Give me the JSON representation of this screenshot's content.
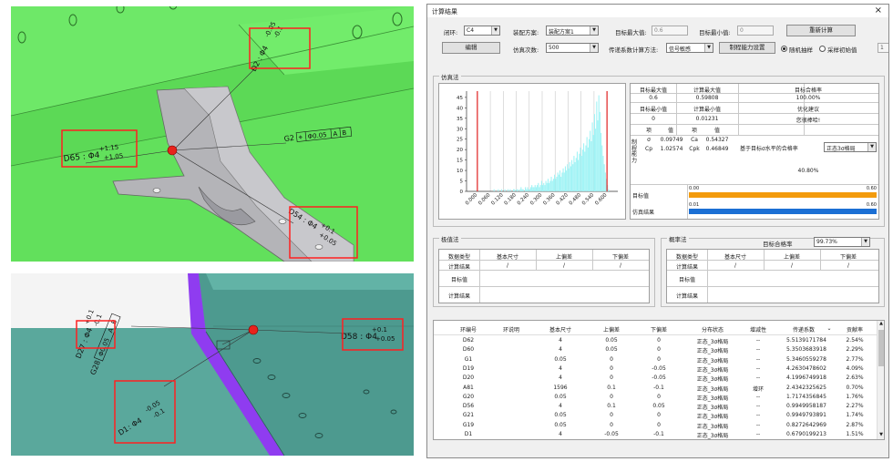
{
  "viewport_top": {
    "annotations": {
      "d2x": "D2",
      "d2x_lower": "-0.05",
      "d2x_upper": "-0.1",
      "d2x_size": ": Φ4",
      "d65_label": "D65 : Φ4",
      "d65_upper": "+1.15",
      "d65_lower": "+1.05",
      "g2x_label": "G2",
      "g2x_symbol": "⌖",
      "g2x_tol": "Φ0.05",
      "g2x_ref_a": "A",
      "g2x_ref_b": "B",
      "d54_label": "D54 : Φ4",
      "d54_upper": "+0.1",
      "d54_lower": "+0.05"
    },
    "colors": {
      "panel": "#62e05c",
      "part": "#a8a8ac",
      "highlight": "#ff2020",
      "marker": "#e8231c"
    }
  },
  "viewport_bottom": {
    "annotations": {
      "d27_label": "D27 : Φ4",
      "d27_upper": "+0.1",
      "d27_lower": "-0.1",
      "g28_label": "G28",
      "g28_tol": "Φ0.05",
      "g28_ref_a": "A",
      "g28_ref_b": "B",
      "d58_label": "D58 : Φ4",
      "d58_upper": "+0.1",
      "d58_lower": "+0.05",
      "d18_label": "D1",
      "d18_size": ": Φ4",
      "d18_upper": "-0.05",
      "d18_lower": "-0.1"
    },
    "colors": {
      "panel": "#4d9a8f",
      "edge": "#8f3cf0"
    }
  },
  "dialog": {
    "title": "计算结果",
    "close": "×",
    "toolbar": {
      "ring_label": "闭环:",
      "ring_value": "C4",
      "plan_label": "装配方案:",
      "plan_value": "装配方案1",
      "target_max_label": "目标最大值:",
      "target_max_value": "0.6",
      "target_min_label": "目标最小值:",
      "target_min_value": "0",
      "recalc_button": "重新计算",
      "edit_button": "编辑",
      "sim_count_label": "仿真次数:",
      "sim_count_value": "500",
      "coef_method_label": "传递系数计算方法:",
      "coef_method_value": "信号敏感",
      "control_setting_button": "制程能力设置",
      "random_sampling_label": "随机抽样",
      "initial_value_label": "采样初始值",
      "initial_value": "1"
    },
    "simulation": {
      "group_label": "仿真法",
      "stats": {
        "max_label": "目标最大值",
        "max_value": "0.6",
        "calc_max_label": "计算最大值",
        "calc_max_value": "0.59808",
        "pass_rate_label": "目标合格率",
        "pass_rate_value": "100.00%",
        "min_label": "目标最小值",
        "min_value": "0",
        "calc_min_label": "计算最小值",
        "calc_min_value": "0.01231",
        "optimize_label": "优化建议",
        "optimize_value": "您很棒哈!",
        "item_label": "项",
        "value_label": "值",
        "sigma_label": "σ",
        "sigma_value": "0.09749",
        "ca_label": "Ca",
        "ca_value": "0.54327",
        "cp_label": "Cp",
        "cp_value": "1.02574",
        "cpk_label": "Cpk",
        "cpk_value": "0.46849",
        "side_label": "制程能力",
        "sigma_rate_label": "基于目标σ水平的合格率",
        "sigma_rate_combo": "正态3σ格局",
        "sigma_rate_value": "40.80%",
        "target_bar_label": "目标值",
        "target_bar_left": "0.00",
        "target_bar_right": "0.60",
        "sim_bar_label": "仿真结果",
        "sim_bar_left": "0.01",
        "sim_bar_right": "0.60"
      }
    },
    "extreme": {
      "group_label": "极值法",
      "headers": [
        "数据类型",
        "基本尺寸",
        "上偏差",
        "下偏差"
      ],
      "row1": [
        "计算结果",
        "/",
        "/",
        "/"
      ],
      "row2_label": "目标值",
      "row3_label": "计算结果"
    },
    "probability": {
      "group_label": "概率法",
      "target_rate_label": "目标合格率",
      "target_rate_value": "99.73%",
      "headers": [
        "数据类型",
        "基本尺寸",
        "上偏差",
        "下偏差"
      ],
      "row1": [
        "计算结果",
        "/",
        "/",
        "/"
      ],
      "row2_label": "目标值",
      "row3_label": "计算结果"
    },
    "table": {
      "headers": [
        "环编号",
        "环说明",
        "基本尺寸",
        "上偏差",
        "下偏差",
        "分布状态",
        "增减性",
        "传递系数",
        "贡献率"
      ],
      "rows": [
        [
          "D62",
          "",
          "4",
          "0.05",
          "0",
          "正态_3σ格局",
          "--",
          "5.5139171784",
          "2.54%"
        ],
        [
          "D60",
          "",
          "4",
          "0.05",
          "0",
          "正态_3σ格局",
          "--",
          "5.3503683918",
          "2.29%"
        ],
        [
          "G1",
          "",
          "0.05",
          "0",
          "0",
          "正态_3σ格局",
          "--",
          "5.3460559278",
          "2.77%"
        ],
        [
          "D19",
          "",
          "4",
          "0",
          "-0.05",
          "正态_3σ格局",
          "--",
          "4.2630478602",
          "4.09%"
        ],
        [
          "D20",
          "",
          "4",
          "0",
          "-0.05",
          "正态_3σ格局",
          "--",
          "4.1996749918",
          "2.63%"
        ],
        [
          "A81",
          "",
          "1596",
          "0.1",
          "-0.1",
          "正态_3σ格局",
          "增环",
          "2.4342325625",
          "0.70%"
        ],
        [
          "G20",
          "",
          "0.05",
          "0",
          "0",
          "正态_3σ格局",
          "--",
          "1.7174356845",
          "1.76%"
        ],
        [
          "D56",
          "",
          "4",
          "0.1",
          "0.05",
          "正态_3σ格局",
          "--",
          "0.9949958187",
          "2.27%"
        ],
        [
          "G21",
          "",
          "0.05",
          "0",
          "0",
          "正态_3σ格局",
          "--",
          "0.9949793891",
          "1.74%"
        ],
        [
          "G19",
          "",
          "0.05",
          "0",
          "0",
          "正态_3σ格局",
          "--",
          "0.8272642969",
          "2.87%"
        ],
        [
          "D1",
          "",
          "4",
          "-0.05",
          "-0.1",
          "正态_3σ格局",
          "--",
          "0.6790199213",
          "1.51%"
        ]
      ],
      "sort_icon": "chevron-down-icon"
    }
  },
  "chart_data": {
    "type": "bar",
    "title": "",
    "xlabel": "",
    "ylabel": "",
    "ylim": [
      0,
      48
    ],
    "xlim": [
      -0.05,
      0.65
    ],
    "x_ticks": [
      "0.000",
      "0.060",
      "0.120",
      "0.180",
      "0.240",
      "0.300",
      "0.360",
      "0.420",
      "0.480",
      "0.540",
      "0.600"
    ],
    "y_ticks": [
      0,
      5,
      10,
      15,
      20,
      25,
      30,
      35,
      40,
      45
    ],
    "limit_lines": [
      0.0,
      0.6
    ],
    "bar_color": "#9ff3f5",
    "limit_color": "#e02020",
    "bin_start": 0.01,
    "bin_width": 0.005,
    "values": [
      0,
      0,
      0,
      0,
      0,
      0,
      0,
      0,
      0,
      0,
      0,
      0,
      0,
      1,
      0,
      0,
      0,
      1,
      0,
      0,
      1,
      0,
      0,
      1,
      0,
      0,
      1,
      0,
      1,
      0,
      0,
      1,
      1,
      0,
      1,
      1,
      0,
      1,
      2,
      1,
      1,
      0,
      2,
      1,
      2,
      1,
      1,
      2,
      3,
      2,
      2,
      3,
      2,
      3,
      4,
      2,
      3,
      5,
      3,
      4,
      3,
      5,
      4,
      6,
      4,
      5,
      7,
      5,
      6,
      8,
      6,
      7,
      9,
      8,
      10,
      7,
      9,
      11,
      9,
      12,
      10,
      13,
      11,
      14,
      12,
      15,
      13,
      17,
      14,
      16,
      19,
      15,
      18,
      21,
      17,
      20,
      23,
      19,
      22,
      26,
      21,
      25,
      29,
      24,
      33,
      27,
      37,
      30,
      43,
      34,
      46,
      38,
      28,
      22,
      17,
      13,
      9,
      6,
      3,
      1,
      0
    ]
  }
}
